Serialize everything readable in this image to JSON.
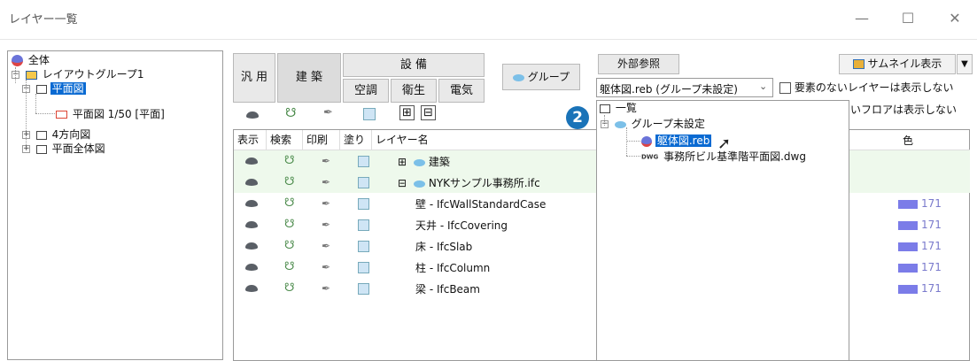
{
  "window": {
    "title": "レイヤー一覧",
    "minimize": "—",
    "maximize": "☐",
    "close": "✕"
  },
  "tree": {
    "all": "全体",
    "layout_group": "レイアウトグループ1",
    "plan": "平面図",
    "plan_sub": "平面図 1/50 [平面]",
    "four_dir": "4方向図",
    "plan_all": "平面全体図"
  },
  "categories": {
    "general": "汎 用",
    "building": "建 築",
    "equipment": "設 備",
    "hvac": "空調",
    "sanitary": "衛生",
    "electric": "電気",
    "group": "グループ"
  },
  "external": {
    "button": "外部参照",
    "selected": "躯体図.reb (グループ未設定)",
    "hide_empty_layers": "要素のないレイヤーは表示しない",
    "hide_floors_partial": "いフロアは表示しない",
    "thumbnail": "サムネイル表示"
  },
  "toolbar": {
    "expand": "⊞",
    "collapse": "⊟"
  },
  "columns": {
    "show": "表示",
    "search": "検索",
    "print": "印刷",
    "fill": "塗り",
    "layer_name": "レイヤー名",
    "color": "色"
  },
  "layers": [
    {
      "name": "建築",
      "prefix": "⊞",
      "group": true,
      "color": ""
    },
    {
      "name": "NYKサンプル事務所.ifc",
      "prefix": "⊟",
      "group": true,
      "color": ""
    },
    {
      "name": "壁 - IfcWallStandardCase",
      "prefix": "",
      "group": false,
      "color": "171"
    },
    {
      "name": "天井 - IfcCovering",
      "prefix": "",
      "group": false,
      "color": "171"
    },
    {
      "name": "床 - IfcSlab",
      "prefix": "",
      "group": false,
      "color": "171"
    },
    {
      "name": "柱 - IfcColumn",
      "prefix": "",
      "group": false,
      "color": "171"
    },
    {
      "name": "梁 - IfcBeam",
      "prefix": "",
      "group": false,
      "color": "171"
    }
  ],
  "popup": {
    "list": "一覧",
    "ungrouped": "グループ未設定",
    "file1": "躯体図.reb",
    "file2": "事務所ビル基準階平面図.dwg",
    "dwg_tag": "DWG"
  },
  "step_badge": "2",
  "colors": {
    "selection": "#0a6ad2",
    "group_row": "#eef9ec",
    "swatch": "#7b7ce8",
    "badge": "#1a73b8"
  }
}
